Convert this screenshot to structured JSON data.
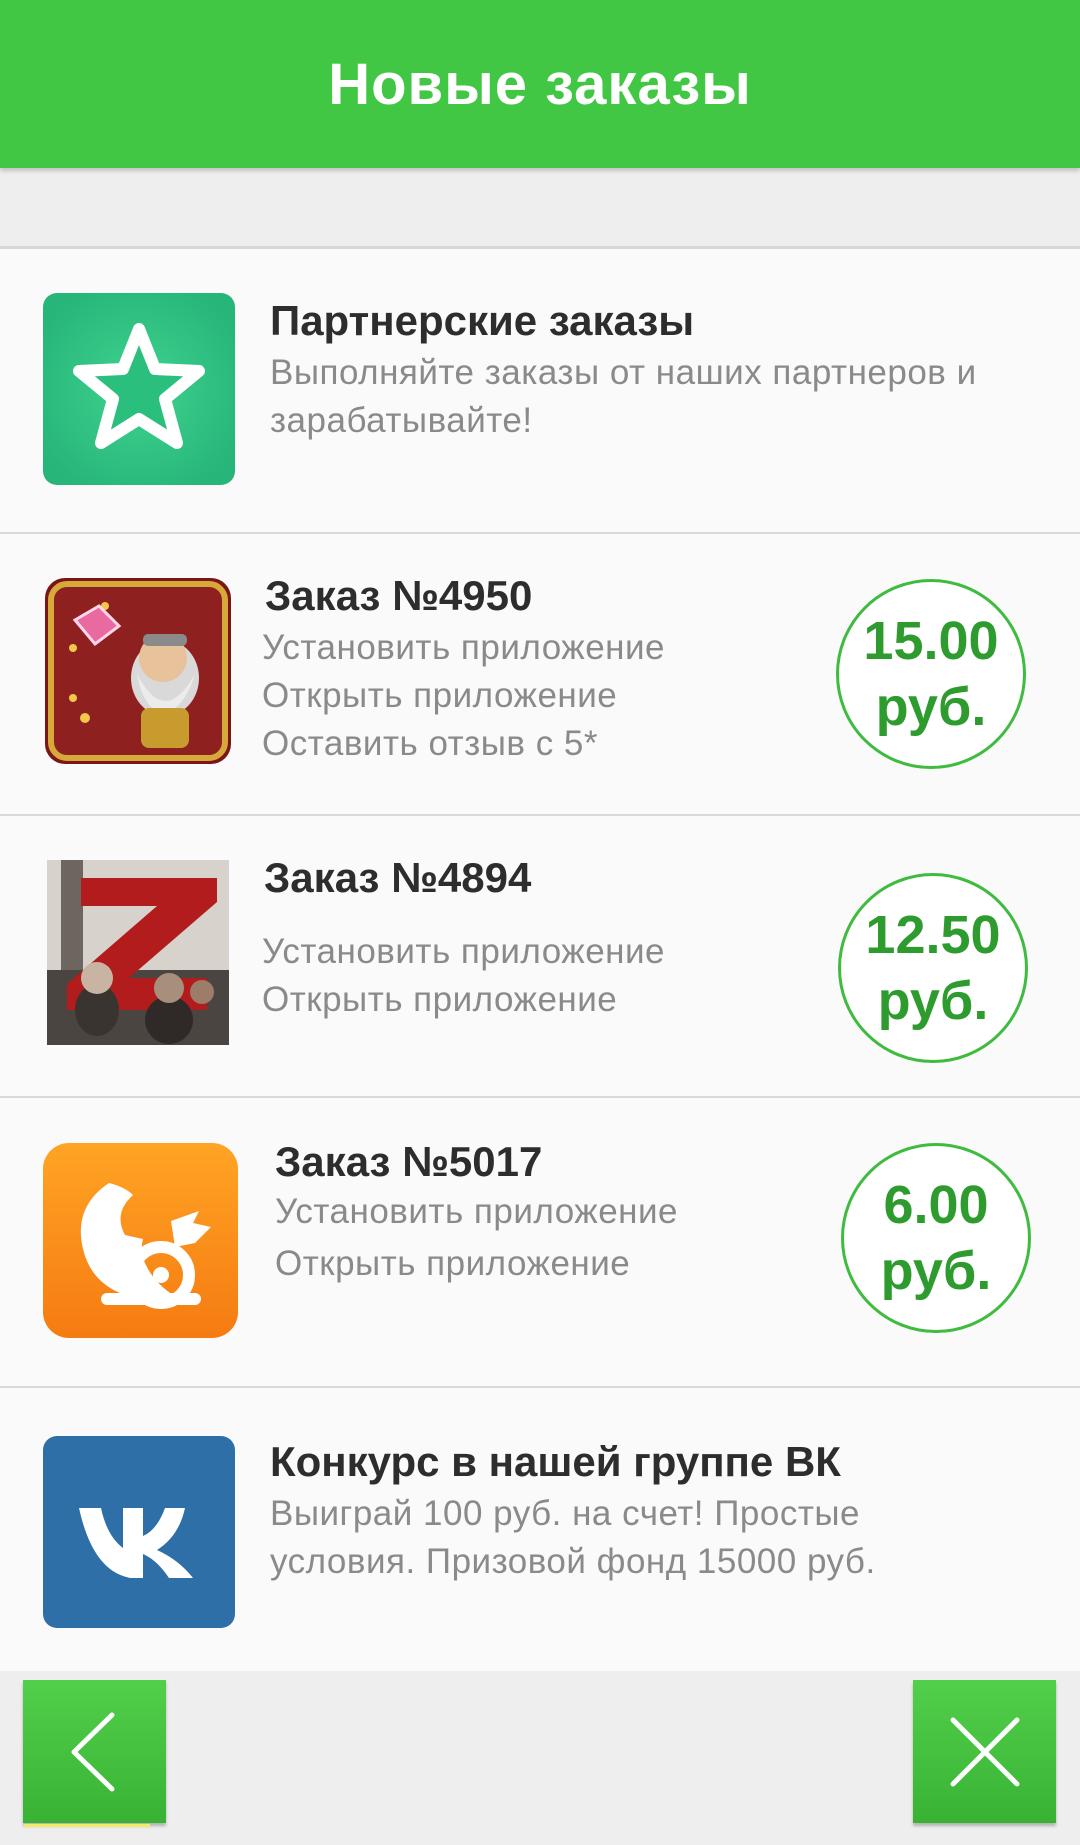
{
  "header": {
    "title": "Новые заказы"
  },
  "partner": {
    "icon": "star-icon",
    "title": "Партнерские заказы",
    "desc_lines": [
      "Выполняйте заказы от наших партнеров и",
      "зарабатывайте!"
    ]
  },
  "orders": [
    {
      "icon": "gold-miner-game-icon",
      "title": "Заказ №4950",
      "tasks": [
        "Установить приложение",
        "Открыть приложение",
        "Оставить отзыв с 5*"
      ],
      "price_value": "15.00",
      "price_unit": "руб."
    },
    {
      "icon": "zombie-game-icon",
      "title": "Заказ №4894",
      "tasks": [
        "Установить приложение",
        "Открыть приложение"
      ],
      "price_value": "12.50",
      "price_unit": "руб."
    },
    {
      "icon": "uc-browser-icon",
      "title": "Заказ №5017",
      "tasks": [
        "Установить приложение",
        "Открыть приложение"
      ],
      "price_value": "6.00",
      "price_unit": "руб."
    }
  ],
  "contest": {
    "icon": "vk-icon",
    "title": "Конкурс в нашей группе ВК",
    "desc_lines": [
      "Выиграй 100 руб. на счет! Простые",
      "условия. Призовой фонд 15000 руб."
    ]
  },
  "nav": {
    "back_icon": "chevron-left-icon",
    "close_icon": "close-icon"
  },
  "colors": {
    "accent": "#42c744",
    "price": "#2e9b2e",
    "vk": "#2f6fa7",
    "uc": "#f7941d"
  }
}
